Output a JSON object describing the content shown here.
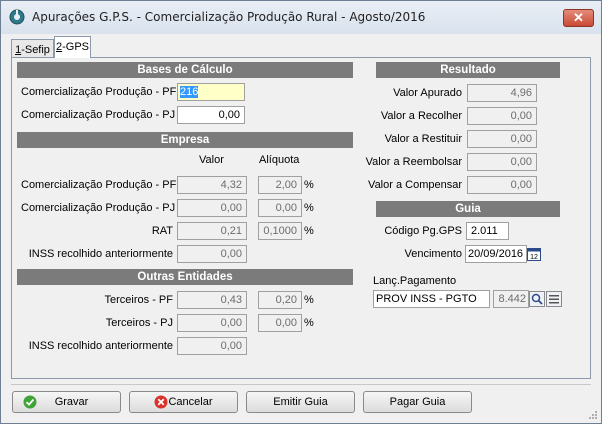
{
  "window": {
    "title": "Apurações G.P.S. - Comercialização Produção Rural - Agosto/2016",
    "close_label": "✕"
  },
  "tabs": [
    {
      "key": "1",
      "rest": "-Sefip"
    },
    {
      "key": "2",
      "rest": "-GPS"
    }
  ],
  "bases": {
    "header": "Bases de Cálculo",
    "pf_label": "Comercialização Produção - PF",
    "pf_value": "216",
    "pj_label": "Comercialização Produção - PJ",
    "pj_value": "0,00"
  },
  "empresa": {
    "header": "Empresa",
    "col_valor": "Valor",
    "col_aliquota": "Alíquota",
    "rows": [
      {
        "label": "Comercialização Produção - PF",
        "valor": "4,32",
        "aliquota": "2,00",
        "pct": "%"
      },
      {
        "label": "Comercialização Produção - PJ",
        "valor": "0,00",
        "aliquota": "0,00",
        "pct": "%"
      },
      {
        "label": "RAT",
        "valor": "0,21",
        "aliquota": "0,1000",
        "pct": "%"
      },
      {
        "label": "INSS recolhido anteriormente",
        "valor": "0,00"
      }
    ]
  },
  "outras": {
    "header": "Outras Entidades",
    "rows": [
      {
        "label": "Terceiros - PF",
        "valor": "0,43",
        "aliquota": "0,20",
        "pct": "%"
      },
      {
        "label": "Terceiros - PJ",
        "valor": "0,00",
        "aliquota": "0,00",
        "pct": "%"
      },
      {
        "label": "INSS recolhido anteriormente",
        "valor": "0,00"
      }
    ]
  },
  "resultado": {
    "header": "Resultado",
    "rows": [
      {
        "label": "Valor Apurado",
        "value": "4,96"
      },
      {
        "label": "Valor a Recolher",
        "value": "0,00"
      },
      {
        "label": "Valor a Restituir",
        "value": "0,00"
      },
      {
        "label": "Valor a Reembolsar",
        "value": "0,00"
      },
      {
        "label": "Valor a Compensar",
        "value": "0,00"
      }
    ]
  },
  "guia": {
    "header": "Guia",
    "codigo_label": "Código Pg.GPS",
    "codigo_value": "2.011",
    "vencimento_label": "Vencimento",
    "vencimento_value": "20/09/2016",
    "calendar_day": "12",
    "lanc_label": "Lanç.Pagamento",
    "lanc_desc": "PROV INSS - PGTO",
    "lanc_code": "8.442"
  },
  "buttons": {
    "gravar": "Gravar",
    "cancelar": "Cancelar",
    "emitir": "Emitir Guia",
    "pagar": "Pagar Guia"
  },
  "colors": {
    "section_header": "#7b7b7b",
    "focus_field": "#ffffc8",
    "selection": "#3399ff"
  }
}
